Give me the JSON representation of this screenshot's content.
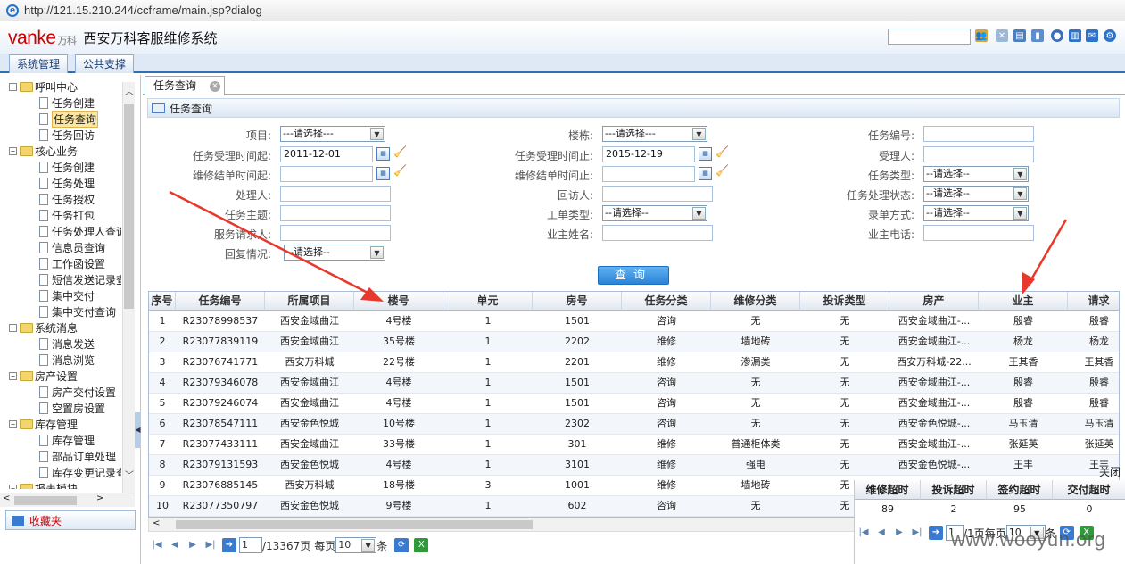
{
  "browser": {
    "url": "http://121.15.210.244/ccframe/main.jsp?dialog"
  },
  "header": {
    "logo_text": "vanke",
    "logo_cn": "万科",
    "title": "西安万科客服维修系统"
  },
  "menubar": {
    "tabs": [
      "系统管理",
      "公共支撑"
    ]
  },
  "sidebar": {
    "items": [
      {
        "label": "呼叫中心",
        "level": 0
      },
      {
        "label": "任务创建",
        "level": 1
      },
      {
        "label": "任务查询",
        "level": 1,
        "selected": true
      },
      {
        "label": "任务回访",
        "level": 1
      },
      {
        "label": "核心业务",
        "level": 0
      },
      {
        "label": "任务创建",
        "level": 1
      },
      {
        "label": "任务处理",
        "level": 1
      },
      {
        "label": "任务授权",
        "level": 1
      },
      {
        "label": "任务打包",
        "level": 1
      },
      {
        "label": "任务处理人查询",
        "level": 1
      },
      {
        "label": "信息员查询",
        "level": 1
      },
      {
        "label": "工作函设置",
        "level": 1
      },
      {
        "label": "短信发送记录查询",
        "level": 1
      },
      {
        "label": "集中交付",
        "level": 1
      },
      {
        "label": "集中交付查询",
        "level": 1
      },
      {
        "label": "系统消息",
        "level": 0
      },
      {
        "label": "消息发送",
        "level": 1
      },
      {
        "label": "消息浏览",
        "level": 1
      },
      {
        "label": "房产设置",
        "level": 0
      },
      {
        "label": "房产交付设置",
        "level": 1
      },
      {
        "label": "空置房设置",
        "level": 1
      },
      {
        "label": "库存管理",
        "level": 0
      },
      {
        "label": "库存管理",
        "level": 1
      },
      {
        "label": "部品订单处理",
        "level": 1
      },
      {
        "label": "库存变更记录查询",
        "level": 1
      },
      {
        "label": "报表模块",
        "level": 0
      }
    ],
    "favorites": "收藏夹"
  },
  "page_tab": {
    "label": "任务查询"
  },
  "panel": {
    "title": "任务查询"
  },
  "form": {
    "project_label": "项目:",
    "project_value": "---请选择---",
    "accept_from_label": "任务受理时间起:",
    "accept_from_value": "2011-12-01",
    "finish_from_label": "维修结单时间起:",
    "finish_from_value": "",
    "handler_label": "处理人:",
    "subject_label": "任务主题:",
    "requester_label": "服务请求人:",
    "reply_label": "回复情况:",
    "reply_value": "--请选择--",
    "building_label": "楼栋:",
    "building_value": "---请选择---",
    "accept_to_label": "任务受理时间止:",
    "accept_to_value": "2015-12-19",
    "finish_to_label": "维修结单时间止:",
    "finish_to_value": "",
    "visitor_label": "回访人:",
    "order_type_label": "工单类型:",
    "order_type_value": "--请选择--",
    "owner_name_label": "业主姓名:",
    "task_no_label": "任务编号:",
    "receiver_label": "受理人:",
    "task_type_label": "任务类型:",
    "task_type_value": "--请选择--",
    "task_status_label": "任务处理状态:",
    "task_status_value": "--请选择--",
    "entry_mode_label": "录单方式:",
    "entry_mode_value": "--请选择--",
    "owner_phone_label": "业主电话:",
    "query_button": "查询"
  },
  "grid": {
    "columns": [
      "序号",
      "任务编号",
      "所属项目",
      "楼号",
      "单元",
      "房号",
      "任务分类",
      "维修分类",
      "投诉类型",
      "房产",
      "业主",
      "请求"
    ],
    "rows": [
      [
        "1",
        "R23078998537",
        "西安金域曲江",
        "4号楼",
        "1",
        "1501",
        "咨询",
        "无",
        "无",
        "西安金域曲江-...",
        "殷睿",
        "殷睿"
      ],
      [
        "2",
        "R23077839119",
        "西安金域曲江",
        "35号楼",
        "1",
        "2202",
        "维修",
        "墙地砖",
        "无",
        "西安金域曲江-...",
        "杨龙",
        "杨龙"
      ],
      [
        "3",
        "R23076741771",
        "西安万科城",
        "22号楼",
        "1",
        "2201",
        "维修",
        "渗漏类",
        "无",
        "西安万科城-22...",
        "王其香",
        "王其香"
      ],
      [
        "4",
        "R23079346078",
        "西安金域曲江",
        "4号楼",
        "1",
        "1501",
        "咨询",
        "无",
        "无",
        "西安金域曲江-...",
        "殷睿",
        "殷睿"
      ],
      [
        "5",
        "R23079246074",
        "西安金域曲江",
        "4号楼",
        "1",
        "1501",
        "咨询",
        "无",
        "无",
        "西安金域曲江-...",
        "殷睿",
        "殷睿"
      ],
      [
        "6",
        "R23078547111",
        "西安金色悦城",
        "10号楼",
        "1",
        "2302",
        "咨询",
        "无",
        "无",
        "西安金色悦城-...",
        "马玉清",
        "马玉清"
      ],
      [
        "7",
        "R23077433111",
        "西安金域曲江",
        "33号楼",
        "1",
        "301",
        "维修",
        "普通柜体类",
        "无",
        "西安金域曲江-...",
        "张延英",
        "张延英"
      ],
      [
        "8",
        "R23079131593",
        "西安金色悦城",
        "4号楼",
        "1",
        "3101",
        "维修",
        "强电",
        "无",
        "西安金色悦城-...",
        "王丰",
        "王丰"
      ],
      [
        "9",
        "R23076885145",
        "西安万科城",
        "18号楼",
        "3",
        "1001",
        "维修",
        "墙地砖",
        "无",
        "",
        "",
        ""
      ],
      [
        "10",
        "R23077350797",
        "西安金色悦城",
        "9号楼",
        "1",
        "602",
        "咨询",
        "无",
        "无",
        "",
        "",
        ""
      ]
    ]
  },
  "pager": {
    "page": "1",
    "total": "/13367页",
    "per_page_label": "每页",
    "per_page_value": "10",
    "unit": "条"
  },
  "stats": {
    "close_label": "关闭",
    "columns": [
      "维修超时",
      "投诉超时",
      "签约超时",
      "交付超时"
    ],
    "values": [
      "89",
      "2",
      "95",
      "0"
    ],
    "page": "1",
    "page_suffix": "/1页",
    "per_page_label": "每页",
    "per_page_value": "10",
    "unit": "条"
  },
  "watermark": "www.wooyun.org",
  "colors": {
    "accent": "#2f6fb4",
    "arrow": "#e8382b",
    "logo": "#cc0000"
  }
}
